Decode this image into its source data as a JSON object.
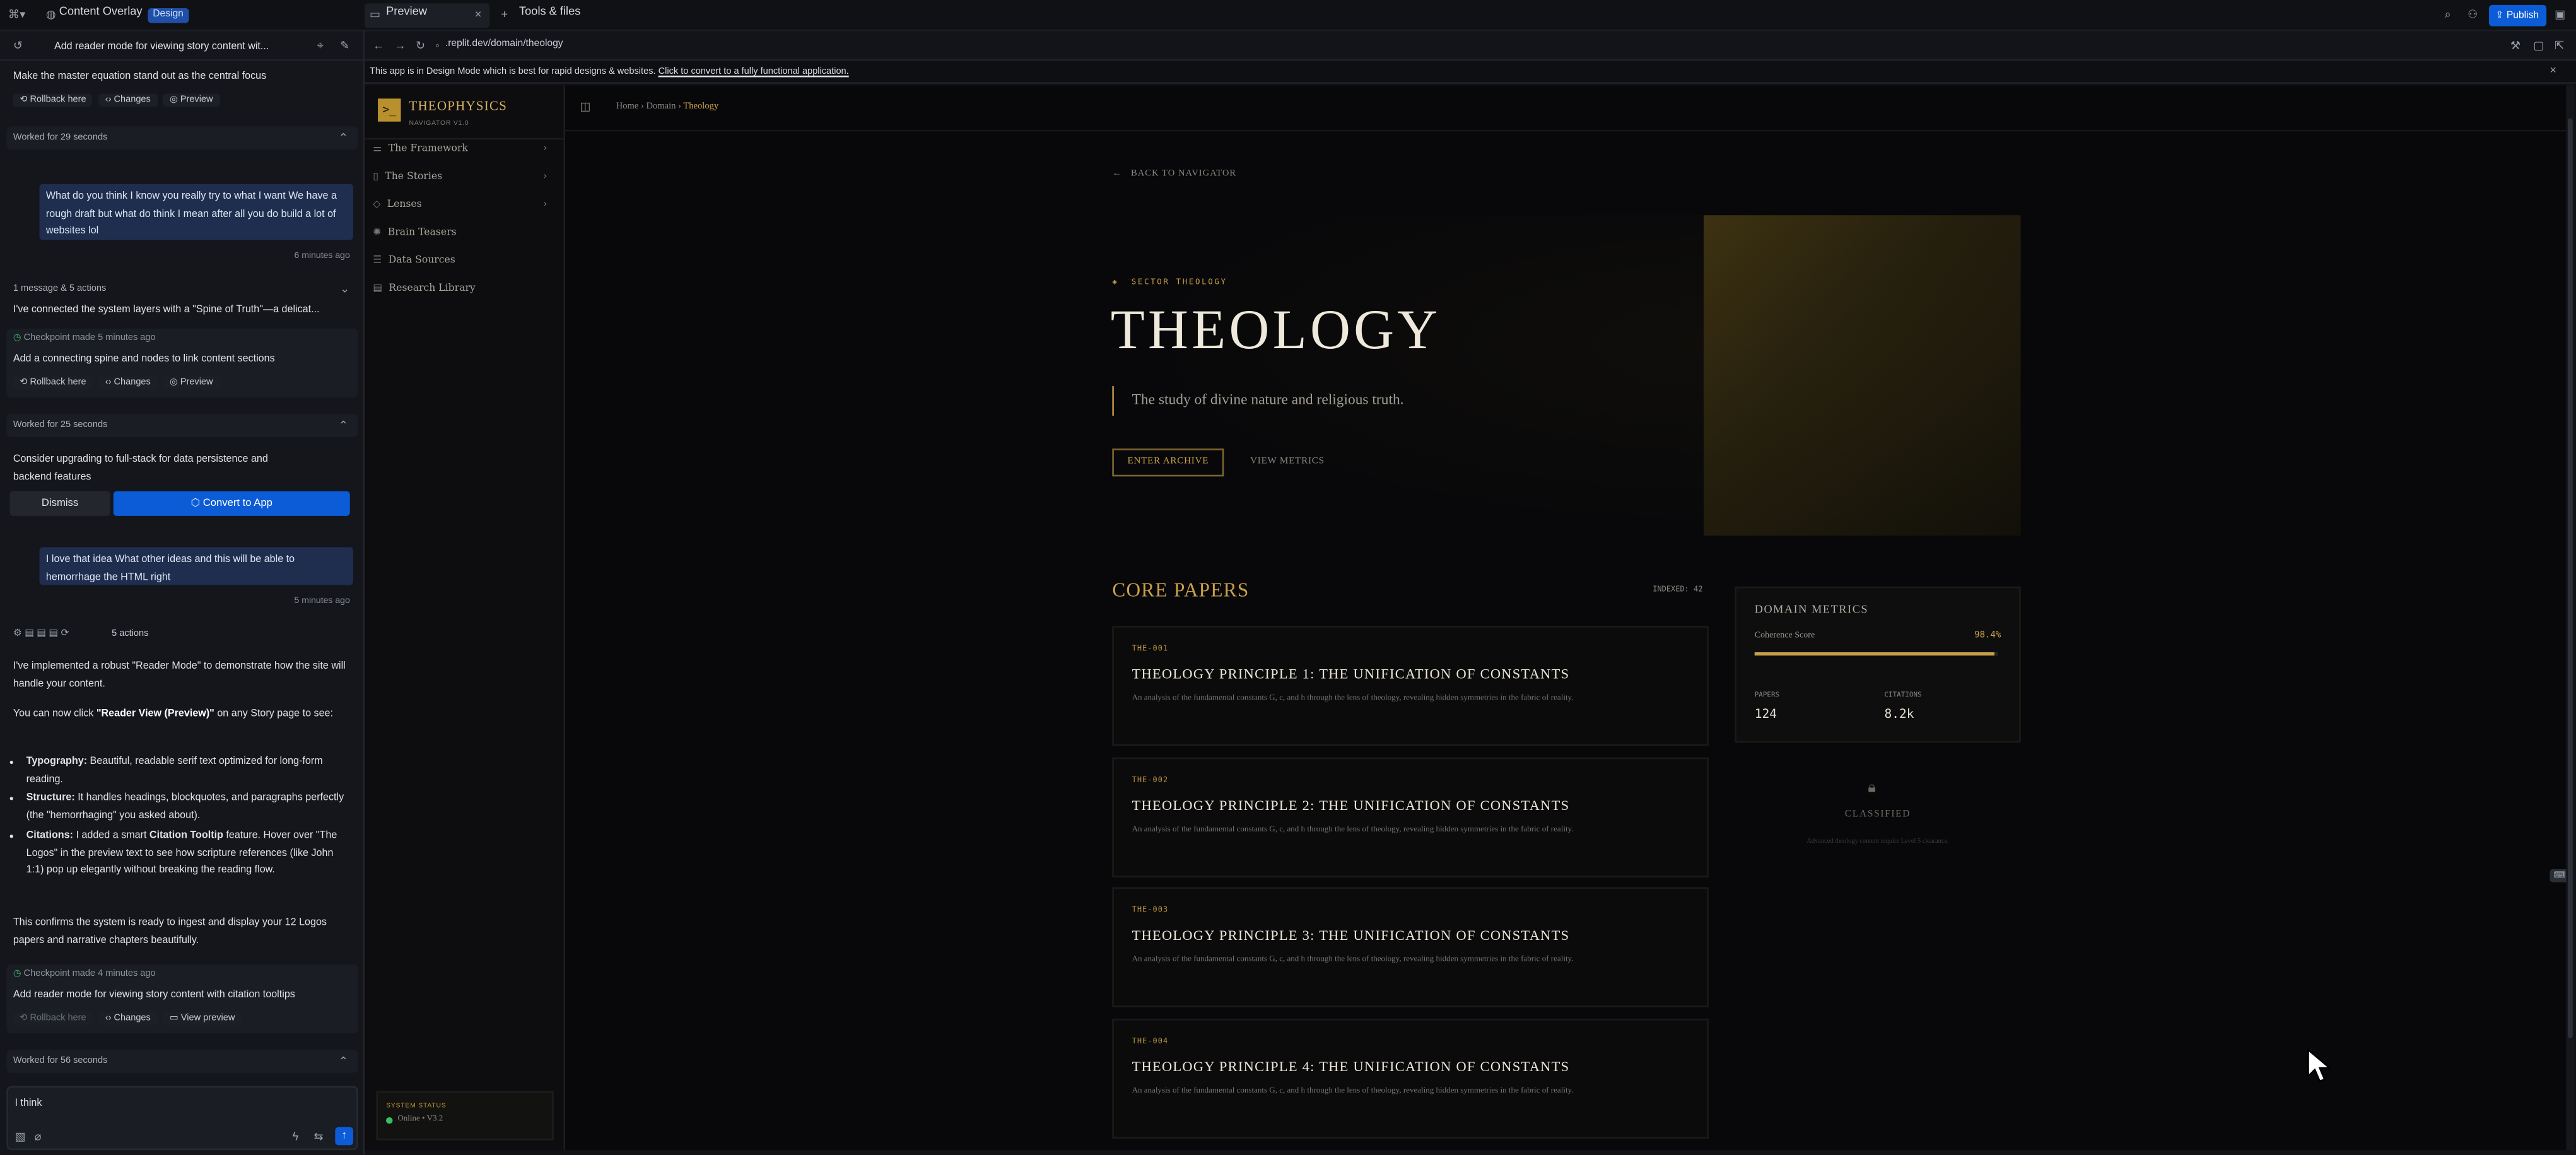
{
  "topbar": {
    "project": "Content Overlay",
    "mode_badge": "Design",
    "tab_preview": "Preview",
    "tab_tools": "Tools & files",
    "publish": "Publish"
  },
  "chat": {
    "header_title": "Add reader mode for viewing story content wit...",
    "items": {
      "msg_top": "Make the master equation stand out as the central focus",
      "rollback": "Rollback here",
      "changes": "Changes",
      "preview": "Preview",
      "view_preview": "View preview",
      "worked_1": "Worked for 29 seconds",
      "user_1": "What do you think I know you really try to what I want We have a rough draft but what do think I mean after all you do build a lot of websites lol",
      "ago_1": "6 minutes ago",
      "actions_1": "1 message & 5 actions",
      "spine": "I've connected the system layers with a \"Spine of Truth\"—a delicat...",
      "checkpoint_1": "Checkpoint made 5 minutes ago",
      "check_1_title": "Add a connecting spine and nodes to link content sections",
      "worked_2": "Worked for 25 seconds",
      "upgrade": "Consider upgrading to full-stack for data persistence and backend features",
      "dismiss": "Dismiss",
      "convert": "Convert to App",
      "user_2": "I love that idea What other ideas and this will be able to hemorrhage the HTML right",
      "ago_2": "5 minutes ago",
      "actions_2": "5 actions",
      "impl_1": "I've implemented a robust \"Reader Mode\" to demonstrate how the site will handle your content.",
      "impl_2a": "You can now click ",
      "impl_2b": "\"Reader View (Preview)\"",
      "impl_2c": " on any Story page to see:",
      "b1_h": "Typography:",
      "b1": " Beautiful, readable serif text optimized for long-form reading.",
      "b2_h": "Structure:",
      "b2": " It handles headings, blockquotes, and paragraphs perfectly (the \"hemorrhaging\" you asked about).",
      "b3_h": "Citations:",
      "b3a": " I added a smart ",
      "b3b": "Citation Tooltip",
      "b3c": " feature. Hover over \"The Logos\" in the preview text to see how scripture references (like John 1:1) pop up elegantly without breaking the reading flow.",
      "confirm": "This confirms the system is ready to ingest and display your 12 Logos papers and narrative chapters beautifully.",
      "checkpoint_2": "Checkpoint made 4 minutes ago",
      "check_2_title": "Add reader mode for viewing story content with citation tooltips",
      "worked_3": "Worked for 56 seconds",
      "input_value": "I think"
    }
  },
  "browser": {
    "url": ".replit.dev/domain/theology",
    "notice": "This app is in Design Mode which is best for rapid designs & websites.",
    "notice_link": "Click to convert to a fully functional application."
  },
  "site": {
    "brand": "THEOPHYSICS",
    "brand_sub": "NAVIGATOR V1.0",
    "nav": [
      "The Framework",
      "The Stories",
      "Lenses",
      "Brain Teasers",
      "Data Sources",
      "Research Library"
    ],
    "status_label": "SYSTEM STATUS",
    "status_value": "Online • V3.2",
    "breadcrumb": [
      "Home",
      "Domain",
      "Theology"
    ],
    "back": "BACK TO NAVIGATOR",
    "sector": "SECTOR THEOLOGY",
    "hero_title": "THEOLOGY",
    "hero_sub": "The study of divine nature and religious truth.",
    "enter": "ENTER ARCHIVE",
    "metrics_link": "VIEW METRICS",
    "core_title": "CORE PAPERS",
    "indexed": "INDEXED: 42",
    "papers": [
      {
        "id": "THE-001",
        "title": "THEOLOGY PRINCIPLE 1: THE UNIFICATION OF CONSTANTS",
        "desc": "An analysis of the fundamental constants G, c, and h through the lens of theology, revealing hidden symmetries in the fabric of reality."
      },
      {
        "id": "THE-002",
        "title": "THEOLOGY PRINCIPLE 2: THE UNIFICATION OF CONSTANTS",
        "desc": "An analysis of the fundamental constants G, c, and h through the lens of theology, revealing hidden symmetries in the fabric of reality."
      },
      {
        "id": "THE-003",
        "title": "THEOLOGY PRINCIPLE 3: THE UNIFICATION OF CONSTANTS",
        "desc": "An analysis of the fundamental constants G, c, and h through the lens of theology, revealing hidden symmetries in the fabric of reality."
      },
      {
        "id": "THE-004",
        "title": "THEOLOGY PRINCIPLE 4: THE UNIFICATION OF CONSTANTS",
        "desc": "An analysis of the fundamental constants G, c, and h through the lens of theology, revealing hidden symmetries in the fabric of reality."
      }
    ],
    "metrics": {
      "title": "DOMAIN METRICS",
      "coherence_label": "Coherence Score",
      "coherence_value": "98.4%",
      "coherence_fraction": 0.984,
      "papers_label": "PAPERS",
      "papers_value": "124",
      "citations_label": "CITATIONS",
      "citations_value": "8.2k"
    },
    "classified": "CLASSIFIED",
    "classified_sub": "Advanced theology content require Level 5 clearance."
  },
  "colors": {
    "accent": "#c9a04a",
    "primary_button": "#0b5cd6"
  }
}
